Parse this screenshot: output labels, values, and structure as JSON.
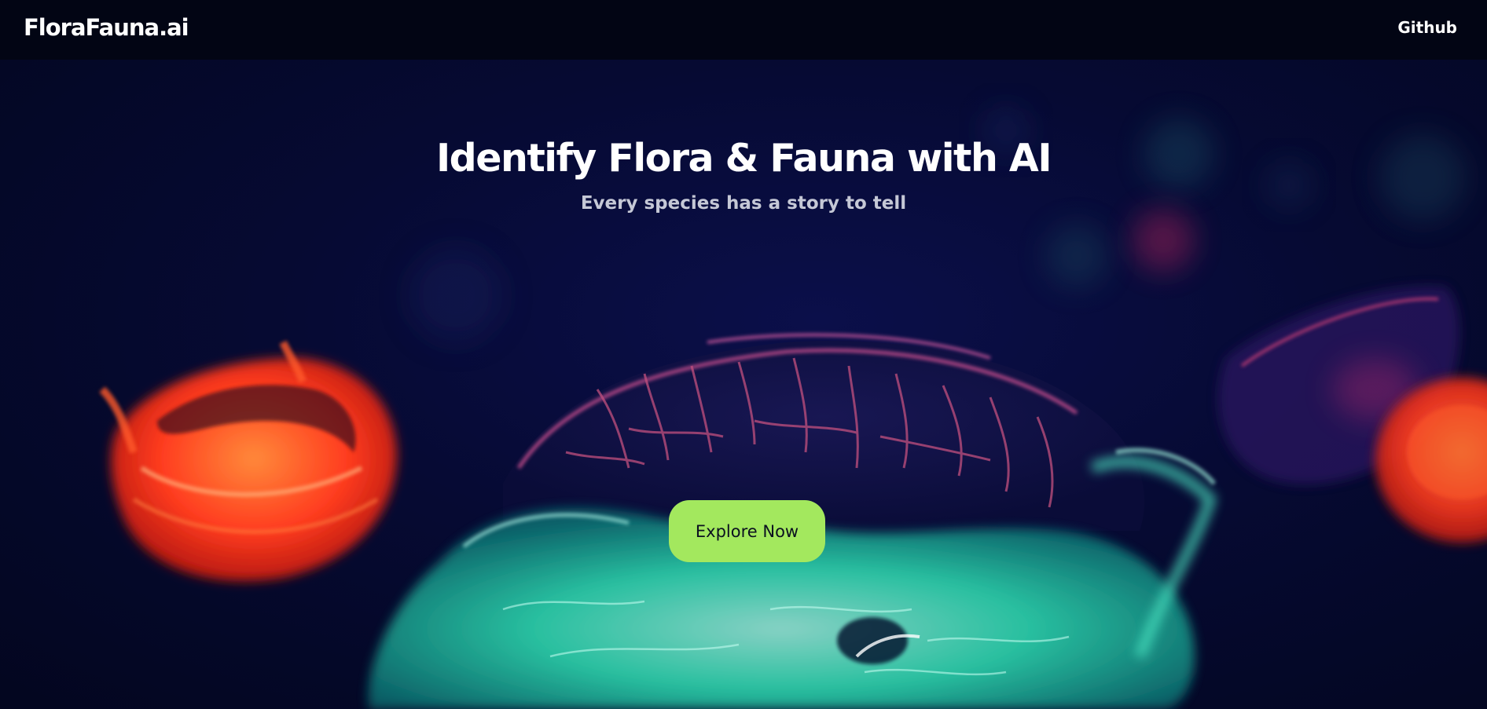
{
  "navbar": {
    "brand": "FloraFauna.ai",
    "github_label": "Github"
  },
  "hero": {
    "title": "Identify Flora & Fauna with AI",
    "subtitle": "Every species has a story to tell",
    "cta_label": "Explore Now",
    "background_image": "jellyfish-underwater-photo"
  },
  "colors": {
    "navbar_bg": "#020514",
    "hero_bg": "#060a33",
    "cta_bg": "#a3e85e",
    "cta_text": "#0b1020",
    "title_text": "#ffffff",
    "subtitle_text": "#c5c8d6",
    "jellyfish_red": "#ff3b1f",
    "jellyfish_teal": "#2fe0b4",
    "jellyfish_pink": "#e0447a"
  }
}
